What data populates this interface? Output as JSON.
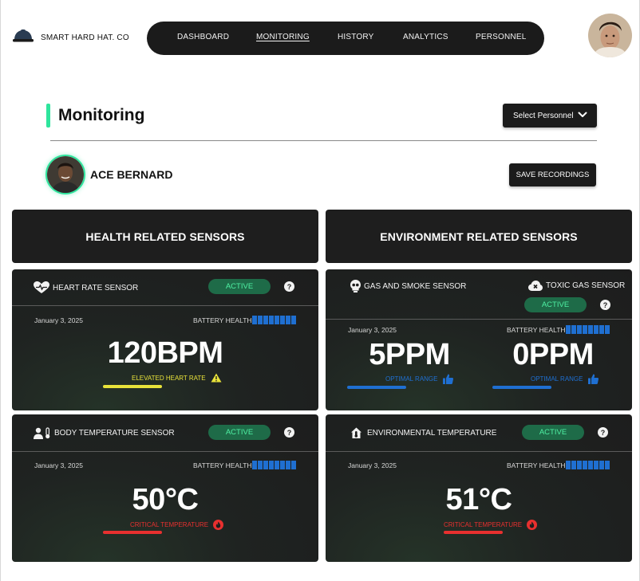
{
  "brand": {
    "name": "SMART HARD HAT. CO",
    "logo_icon": "hard-hat-icon"
  },
  "nav": {
    "items": [
      "DASHBOARD",
      "MONITORING",
      "HISTORY",
      "ANALYTICS",
      "PERSONNEL"
    ],
    "active": "MONITORING"
  },
  "page": {
    "title": "Monitoring",
    "accent_color": "#2ee59d"
  },
  "select_personnel": {
    "label": "Select Personnel",
    "icon": "chevron-down-icon"
  },
  "person": {
    "name": "ACE BERNARD"
  },
  "actions": {
    "save_label": "SAVE RECORDINGS"
  },
  "sections": {
    "health": "HEALTH RELATED SENSORS",
    "environment": "ENVIRONMENT RELATED SENSORS"
  },
  "colors": {
    "active_badge_bg": "#1e6b48",
    "active_badge_text": "#4ff0a3",
    "battery": "#1f6fd1",
    "warning": "#e8e23a",
    "critical": "#e8302f",
    "optimal": "#1f6fd1"
  },
  "sensors": {
    "heart_rate": {
      "name": "HEART RATE SENSOR",
      "icon": "heart-pulse-icon",
      "status": "ACTIVE",
      "date": "January 3, 2025",
      "battery_label": "BATTERY HEALTH",
      "battery_level": 1.0,
      "reading": "120BPM",
      "state": "ELEVATED HEART RATE",
      "state_icon": "warning-icon",
      "bar_level": 0.55
    },
    "body_temp": {
      "name": "BODY TEMPERATURE SENSOR",
      "icon": "person-thermometer-icon",
      "status": "ACTIVE",
      "date": "January 3, 2025",
      "battery_label": "BATTERY HEALTH",
      "battery_level": 1.0,
      "reading": "50°C",
      "state": "CRITICAL TEMPERATURE",
      "state_icon": "fire-icon",
      "bar_level": 0.55
    },
    "gas_smoke": {
      "name": "GAS AND SMOKE SENSOR",
      "icon": "skull-icon",
      "date": "January 3, 2025",
      "battery_label": "BATTERY HEALTH",
      "battery_level": 1.0,
      "reading": "5PPM",
      "state": "OPTIMAL RANGE",
      "state_icon": "thumbs-up-icon",
      "bar_level": 0.55
    },
    "toxic_gas": {
      "name": "TOXIC GAS SENSOR",
      "icon": "cloud-x-icon",
      "status": "ACTIVE",
      "reading": "0PPM",
      "state": "OPTIMAL RANGE",
      "state_icon": "thumbs-up-icon",
      "bar_level": 0.55
    },
    "env_temp": {
      "name": "ENVIRONMENTAL TEMPERATURE",
      "icon": "house-thermometer-icon",
      "status": "ACTIVE",
      "date": "January 3, 2025",
      "battery_label": "BATTERY HEALTH",
      "battery_level": 1.0,
      "reading": "51°C",
      "state": "CRITICAL TEMPERATURE",
      "state_icon": "fire-icon",
      "bar_level": 0.55
    }
  },
  "help_glyph": "?"
}
